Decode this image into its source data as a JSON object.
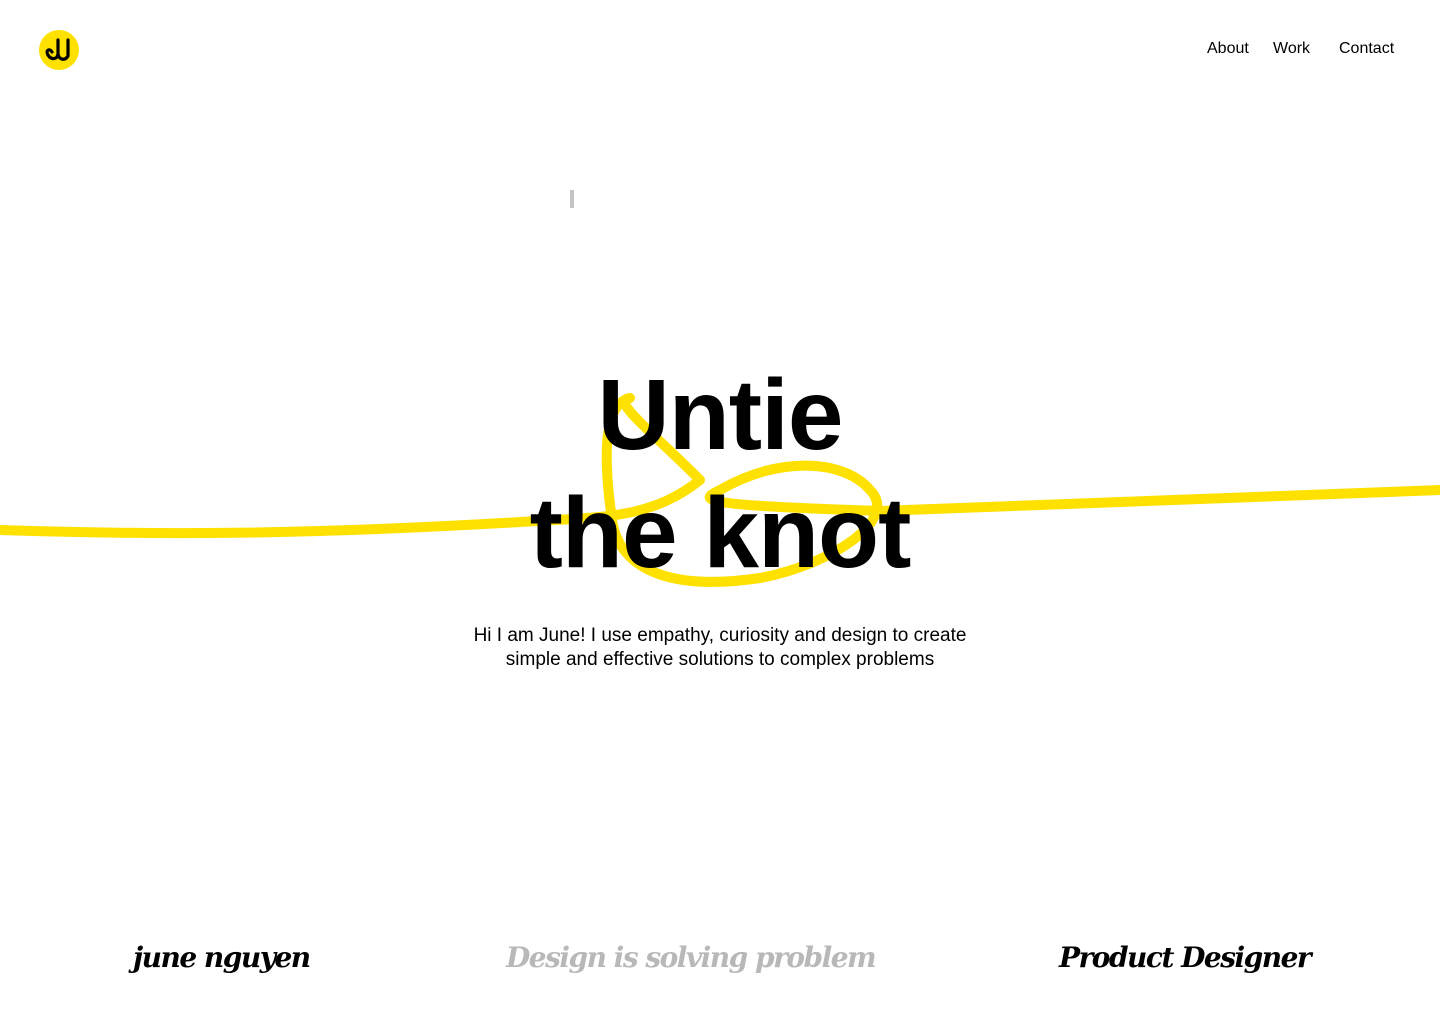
{
  "brand": {
    "logo_icon": "ju-monogram-icon",
    "logo_color": "#FFE100"
  },
  "nav": {
    "about": "About",
    "work": "Work",
    "contact": "Contact"
  },
  "hero": {
    "title_line1": "Untie",
    "title_line2": "the knot",
    "subtitle_line1": "Hi I am June! I use empathy, curiosity and design to create",
    "subtitle_line2": "simple and effective solutions to complex problems",
    "rope_color": "#FFE100"
  },
  "footer": {
    "name": "june nguyen",
    "tagline": "Design is solving problem",
    "role": "Product Designer"
  }
}
